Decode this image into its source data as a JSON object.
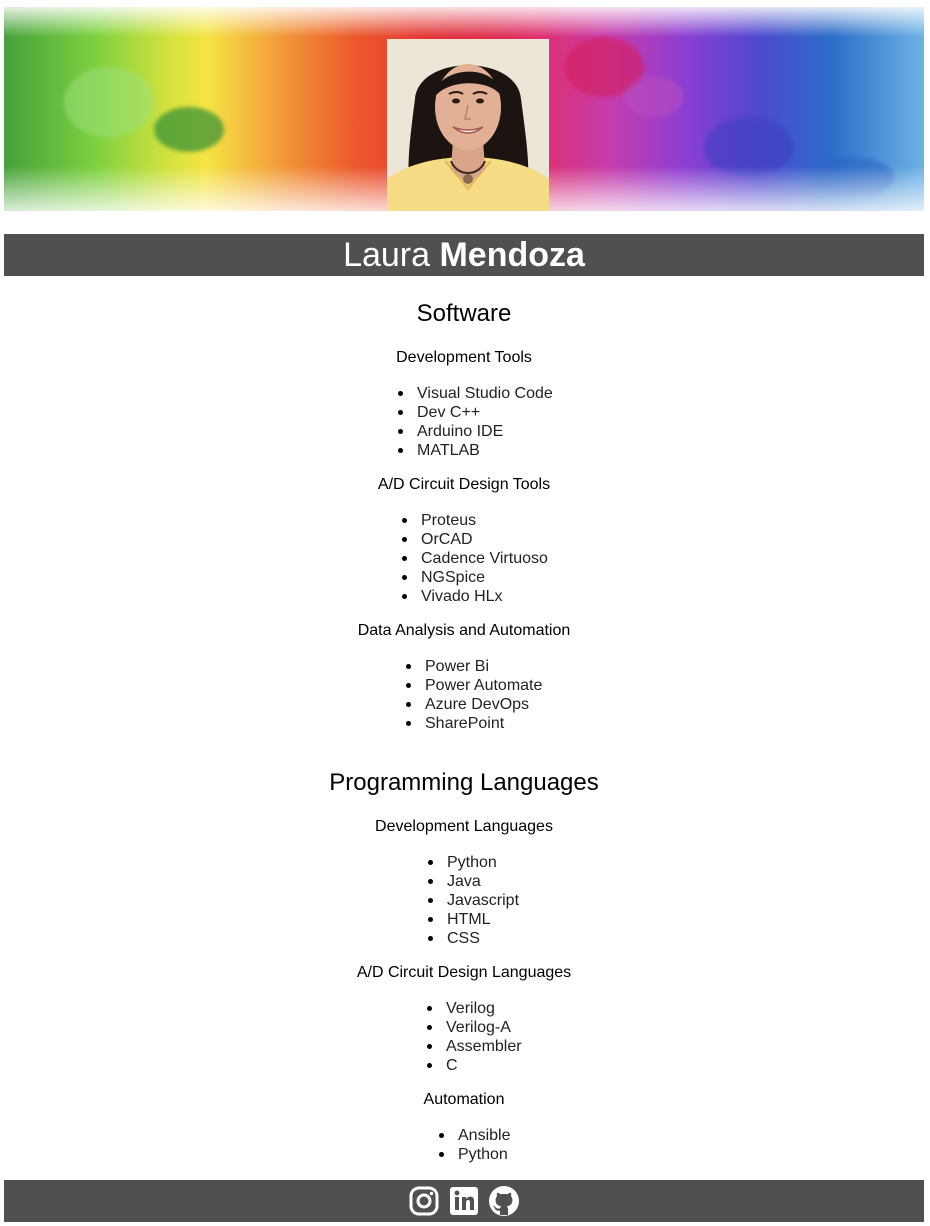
{
  "header": {
    "first_name": "Laura",
    "last_name": "Mendoza"
  },
  "sections": [
    {
      "title": "Software",
      "groups": [
        {
          "title": "Development Tools",
          "items": [
            "Visual Studio Code",
            "Dev C++",
            "Arduino IDE",
            "MATLAB"
          ]
        },
        {
          "title": "A/D Circuit Design Tools",
          "items": [
            "Proteus",
            "OrCAD",
            "Cadence Virtuoso",
            "NGSpice",
            "Vivado HLx"
          ]
        },
        {
          "title": "Data Analysis and Automation",
          "items": [
            "Power Bi",
            "Power Automate",
            "Azure DevOps",
            "SharePoint"
          ]
        }
      ]
    },
    {
      "title": "Programming Languages",
      "groups": [
        {
          "title": "Development Languages",
          "items": [
            "Python",
            "Java",
            "Javascript",
            "HTML",
            "CSS"
          ]
        },
        {
          "title": "A/D Circuit Design Languages",
          "items": [
            "Verilog",
            "Verilog-A",
            "Assembler",
            "C"
          ]
        },
        {
          "title": "Automation",
          "items": [
            "Ansible",
            "Python"
          ]
        }
      ]
    }
  ],
  "footer": {
    "links": [
      {
        "icon": "instagram-icon"
      },
      {
        "icon": "linkedin-icon"
      },
      {
        "icon": "github-icon"
      }
    ]
  }
}
